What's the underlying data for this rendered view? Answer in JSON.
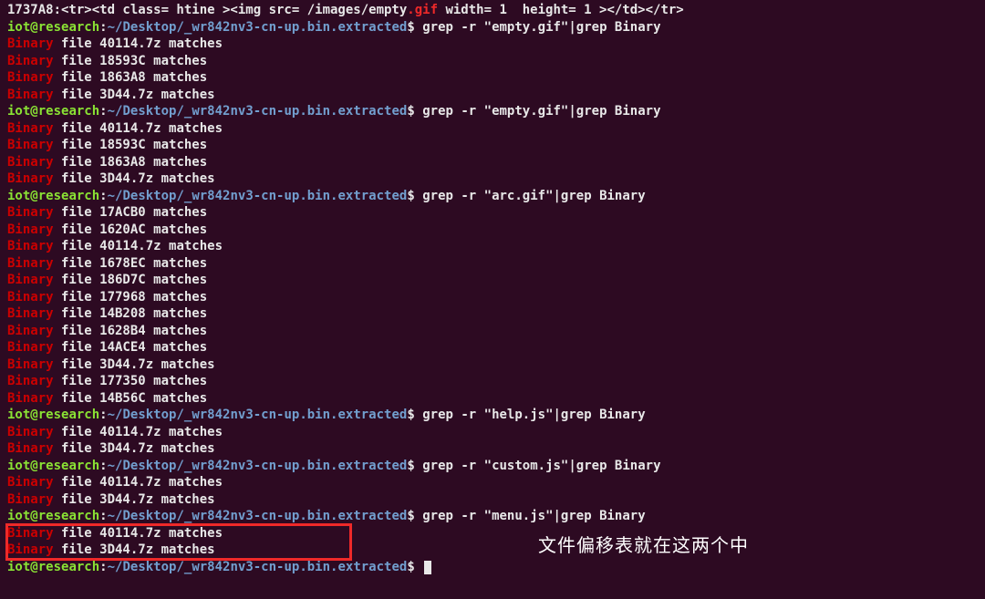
{
  "topline_prefix": "1737A8:<tr><td class= htine ><img src= /images/empty",
  "topline_highlight": ".gif",
  "topline_suffix": " width= 1  height= 1 ></td></tr>",
  "prompt": {
    "user": "iot",
    "at": "@",
    "host": "research",
    "colon": ":",
    "path": "~/Desktop/_wr842nv3-cn-up.bin.extracted",
    "dollar": "$"
  },
  "binary_word": "Binary",
  "file_word": " file ",
  "matches_word": " matches",
  "commands": [
    {
      "cmd": "grep -r \"empty.gif\"|grep Binary",
      "show_topline_before": true,
      "results": [
        "40114.7z",
        "18593C",
        "1863A8",
        "3D44.7z"
      ]
    },
    {
      "cmd": "grep -r \"empty.gif\"|grep Binary",
      "results": [
        "40114.7z",
        "18593C",
        "1863A8",
        "3D44.7z"
      ]
    },
    {
      "cmd": "grep -r \"arc.gif\"|grep Binary",
      "results": [
        "17ACB0",
        "1620AC",
        "40114.7z",
        "1678EC",
        "186D7C",
        "177968",
        "14B208",
        "1628B4",
        "14ACE4",
        "3D44.7z",
        "177350",
        "14B56C"
      ]
    },
    {
      "cmd": "grep -r \"help.js\"|grep Binary",
      "results": [
        "40114.7z",
        "3D44.7z"
      ]
    },
    {
      "cmd": "grep -r \"custom.js\"|grep Binary",
      "results": [
        "40114.7z",
        "3D44.7z"
      ]
    },
    {
      "cmd": "grep -r \"menu.js\"|grep Binary",
      "results": [
        "40114.7z",
        "3D44.7z"
      ],
      "highlight_results": true
    }
  ],
  "final_prompt": true,
  "annotation": "文件偏移表就在这两个中"
}
